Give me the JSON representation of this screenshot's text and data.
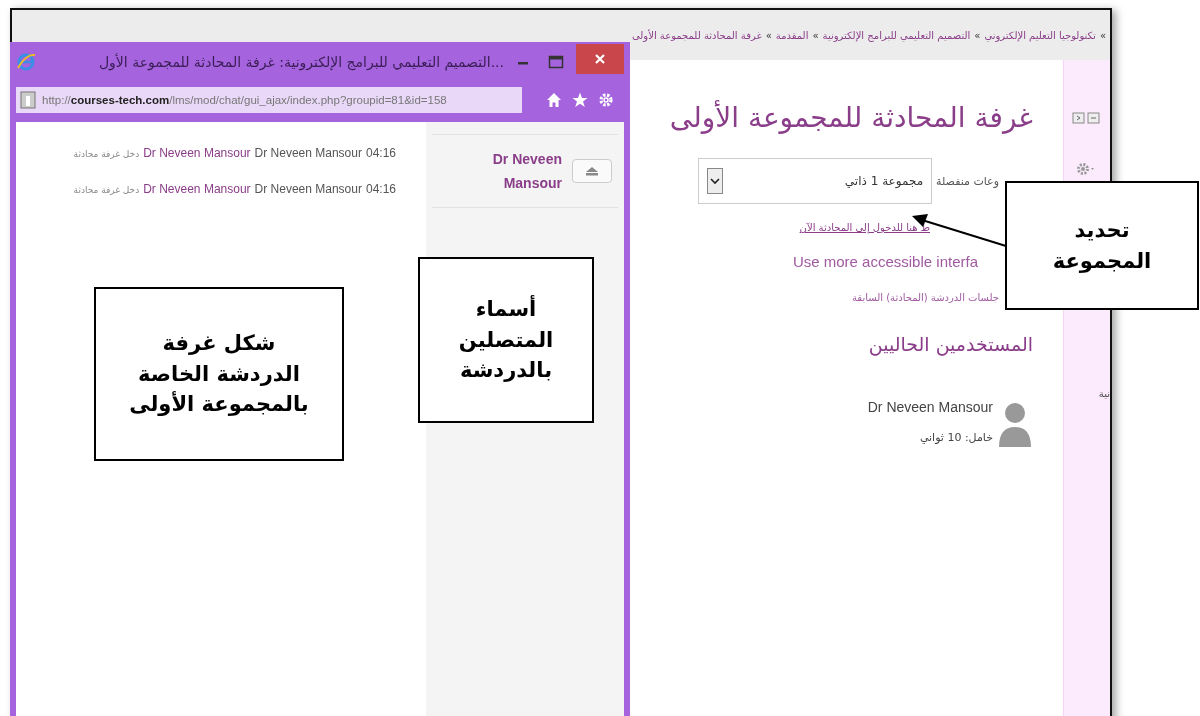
{
  "page": {
    "breadcrumb": {
      "separator": "»",
      "items": [
        "تكنولوجيا التعليم الإلكتروني",
        "التصميم التعليمي للبرامج الإلكترونية",
        "المقدمة",
        "غرفة المحادثة للمجموعة الأولى"
      ]
    },
    "title": "غرفة المحادثة للمجموعة الأولى",
    "group_label": "وعات منفصلة",
    "group_select": "مجموعة 1 ذاتي",
    "enter_link": "ط هنا للدخول إلى المحادثة الآن",
    "accessible_link": "Use more accessible interfa",
    "sessions_link": "جلسات الدردشة (المحادثة) السابقة",
    "current_users_heading": "المستخدمين الحاليين",
    "users": [
      {
        "name": "Dr Neveen Mansour",
        "idle": "خامل: 10 ثواني"
      }
    ],
    "sidebar_text": "نية"
  },
  "popup": {
    "title": "...التصميم التعليمي للبرامج الإلكترونية: غرفة المحادثة للمجموعة الأول",
    "url_scheme": "http://",
    "url_domain": "courses-tech.com",
    "url_path": "/lms/mod/chat/gui_ajax/index.php?groupid=81&id=158",
    "messages": [
      {
        "time": "04:16",
        "user": "Dr Neveen Mansour",
        "user_link": "Dr Neveen Mansour",
        "action": "دخل غرفة محادثة"
      },
      {
        "time": "04:16",
        "user": "Dr Neveen Mansour",
        "user_link": "Dr Neveen Mansour",
        "action": "دخل غرفة محادثة"
      }
    ],
    "online_users": [
      {
        "name": "Dr Neveen Mansour"
      }
    ]
  },
  "annotations": [
    {
      "kind": "chat",
      "text": "شكل غرفة\nالدردشة الخاصة\nبالمجموعة الأولى"
    },
    {
      "kind": "users",
      "text": "أسماء\nالمتصلين\nبالدردشة"
    },
    {
      "kind": "group",
      "text": "تحديد\nالمجموعة"
    }
  ]
}
